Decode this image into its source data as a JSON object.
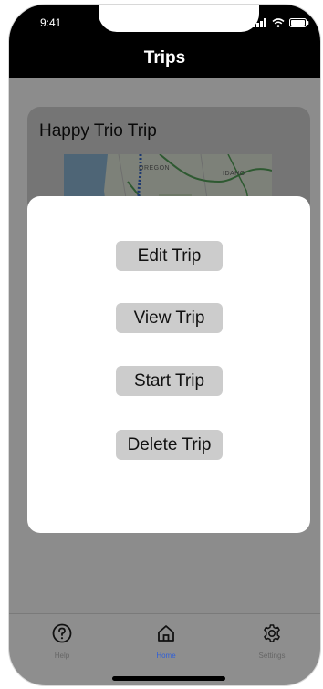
{
  "status_bar": {
    "time": "9:41"
  },
  "header": {
    "title": "Trips"
  },
  "trip_card": {
    "title": "Happy Trio Trip",
    "map_labels": [
      "OREGON",
      "IDAHO"
    ]
  },
  "modal": {
    "actions": [
      {
        "label": "Edit Trip"
      },
      {
        "label": "View Trip"
      },
      {
        "label": "Start Trip"
      },
      {
        "label": "Delete Trip"
      }
    ]
  },
  "tabbar": {
    "items": [
      {
        "label": "Help",
        "icon": "help-icon",
        "active": false
      },
      {
        "label": "Home",
        "icon": "home-icon",
        "active": true
      },
      {
        "label": "Settings",
        "icon": "gear-icon",
        "active": false
      }
    ]
  },
  "colors": {
    "header_bg": "#000000",
    "overlay": "rgba(0,0,0,0.45)",
    "button_bg": "#cccccc",
    "tab_active": "#2f5fd8"
  }
}
